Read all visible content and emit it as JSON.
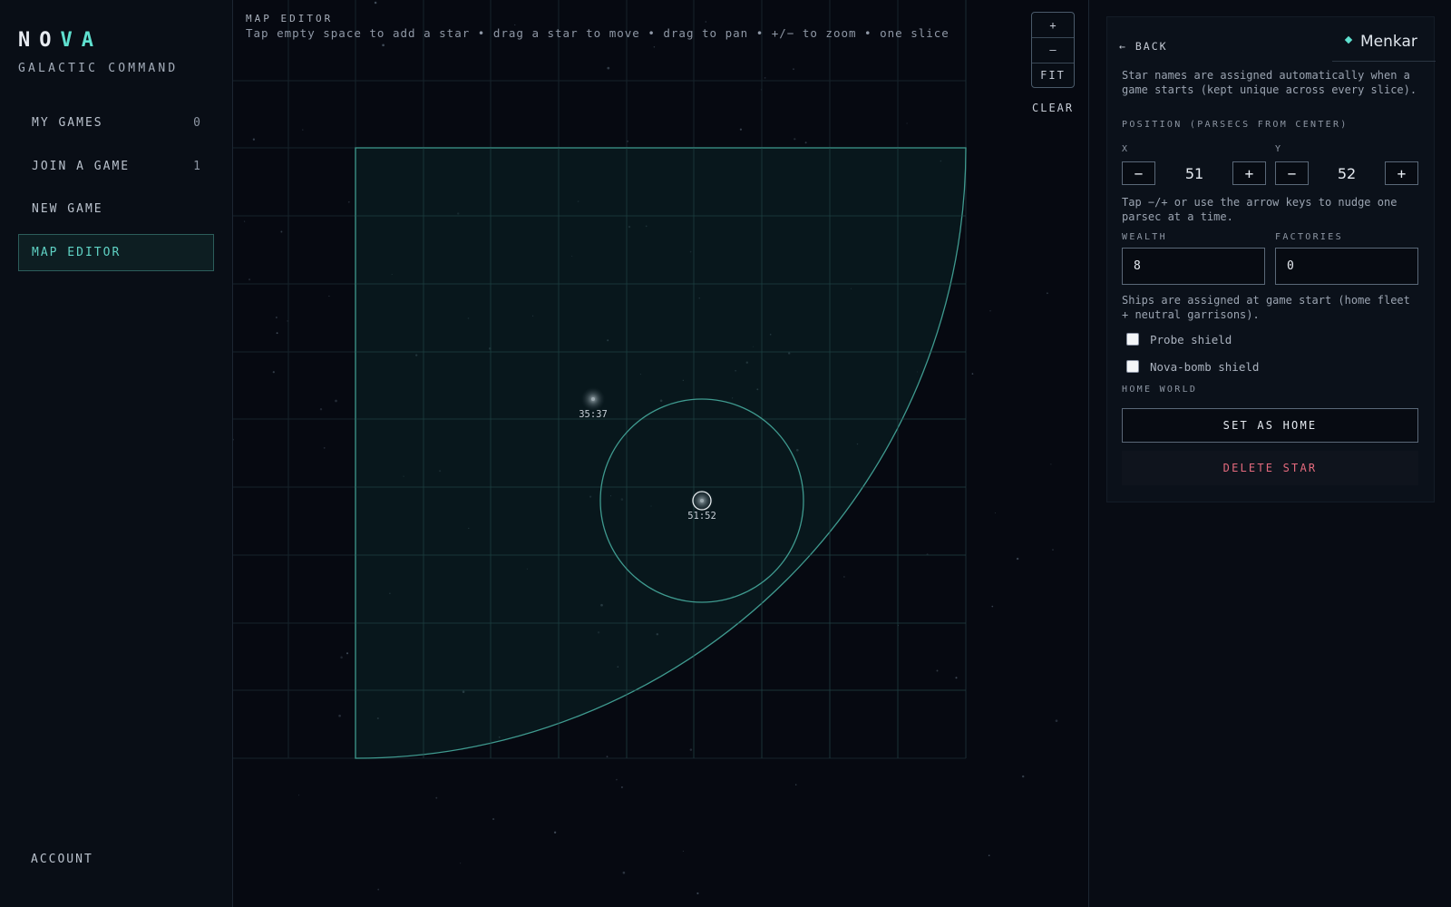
{
  "brand": {
    "name_part1": "NO",
    "name_part2": "VA",
    "subtitle": "GALACTIC COMMAND",
    "accent_color": "#5fe0cf"
  },
  "nav": {
    "items": [
      {
        "label": "MY GAMES",
        "count": "0"
      },
      {
        "label": "JOIN A GAME",
        "count": "1"
      },
      {
        "label": "NEW GAME",
        "count": ""
      },
      {
        "label": "MAP EDITOR",
        "count": "",
        "active": true
      }
    ],
    "account_label": "ACCOUNT"
  },
  "map": {
    "title": "MAP EDITOR",
    "hint": "Tap empty space to add a star • drag a star to move • drag to pan • +/− to zoom • one slice",
    "zoom_in_label": "+",
    "zoom_out_label": "–",
    "fit_label": "FIT",
    "clear_label": "CLEAR",
    "stars": [
      {
        "label": "35:37",
        "selected": false
      },
      {
        "label": "51:52",
        "selected": true
      }
    ]
  },
  "panel": {
    "back_label": "← BACK",
    "star_name": "Menkar",
    "names_note": "Star names are assigned automatically when a game starts (kept unique across every slice).",
    "position_label": "POSITION (PARSECS FROM CENTER)",
    "x_label": "X",
    "y_label": "Y",
    "x_value": "51",
    "y_value": "52",
    "minus_label": "−",
    "plus_label": "+",
    "nudge_note": "Tap −/+ or use the arrow keys to nudge one parsec at a time.",
    "wealth_label": "WEALTH",
    "wealth_value": "8",
    "factories_label": "FACTORIES",
    "factories_value": "0",
    "ships_note": "Ships are assigned at game start (home fleet + neutral garrisons).",
    "probe_shield_label": "Probe shield",
    "probe_shield_checked": false,
    "nova_shield_label": "Nova-bomb shield",
    "nova_shield_checked": false,
    "home_world_label": "HOME WORLD",
    "set_home_label": "SET AS HOME",
    "delete_label": "DELETE STAR",
    "delete_color": "#e46a7d"
  }
}
